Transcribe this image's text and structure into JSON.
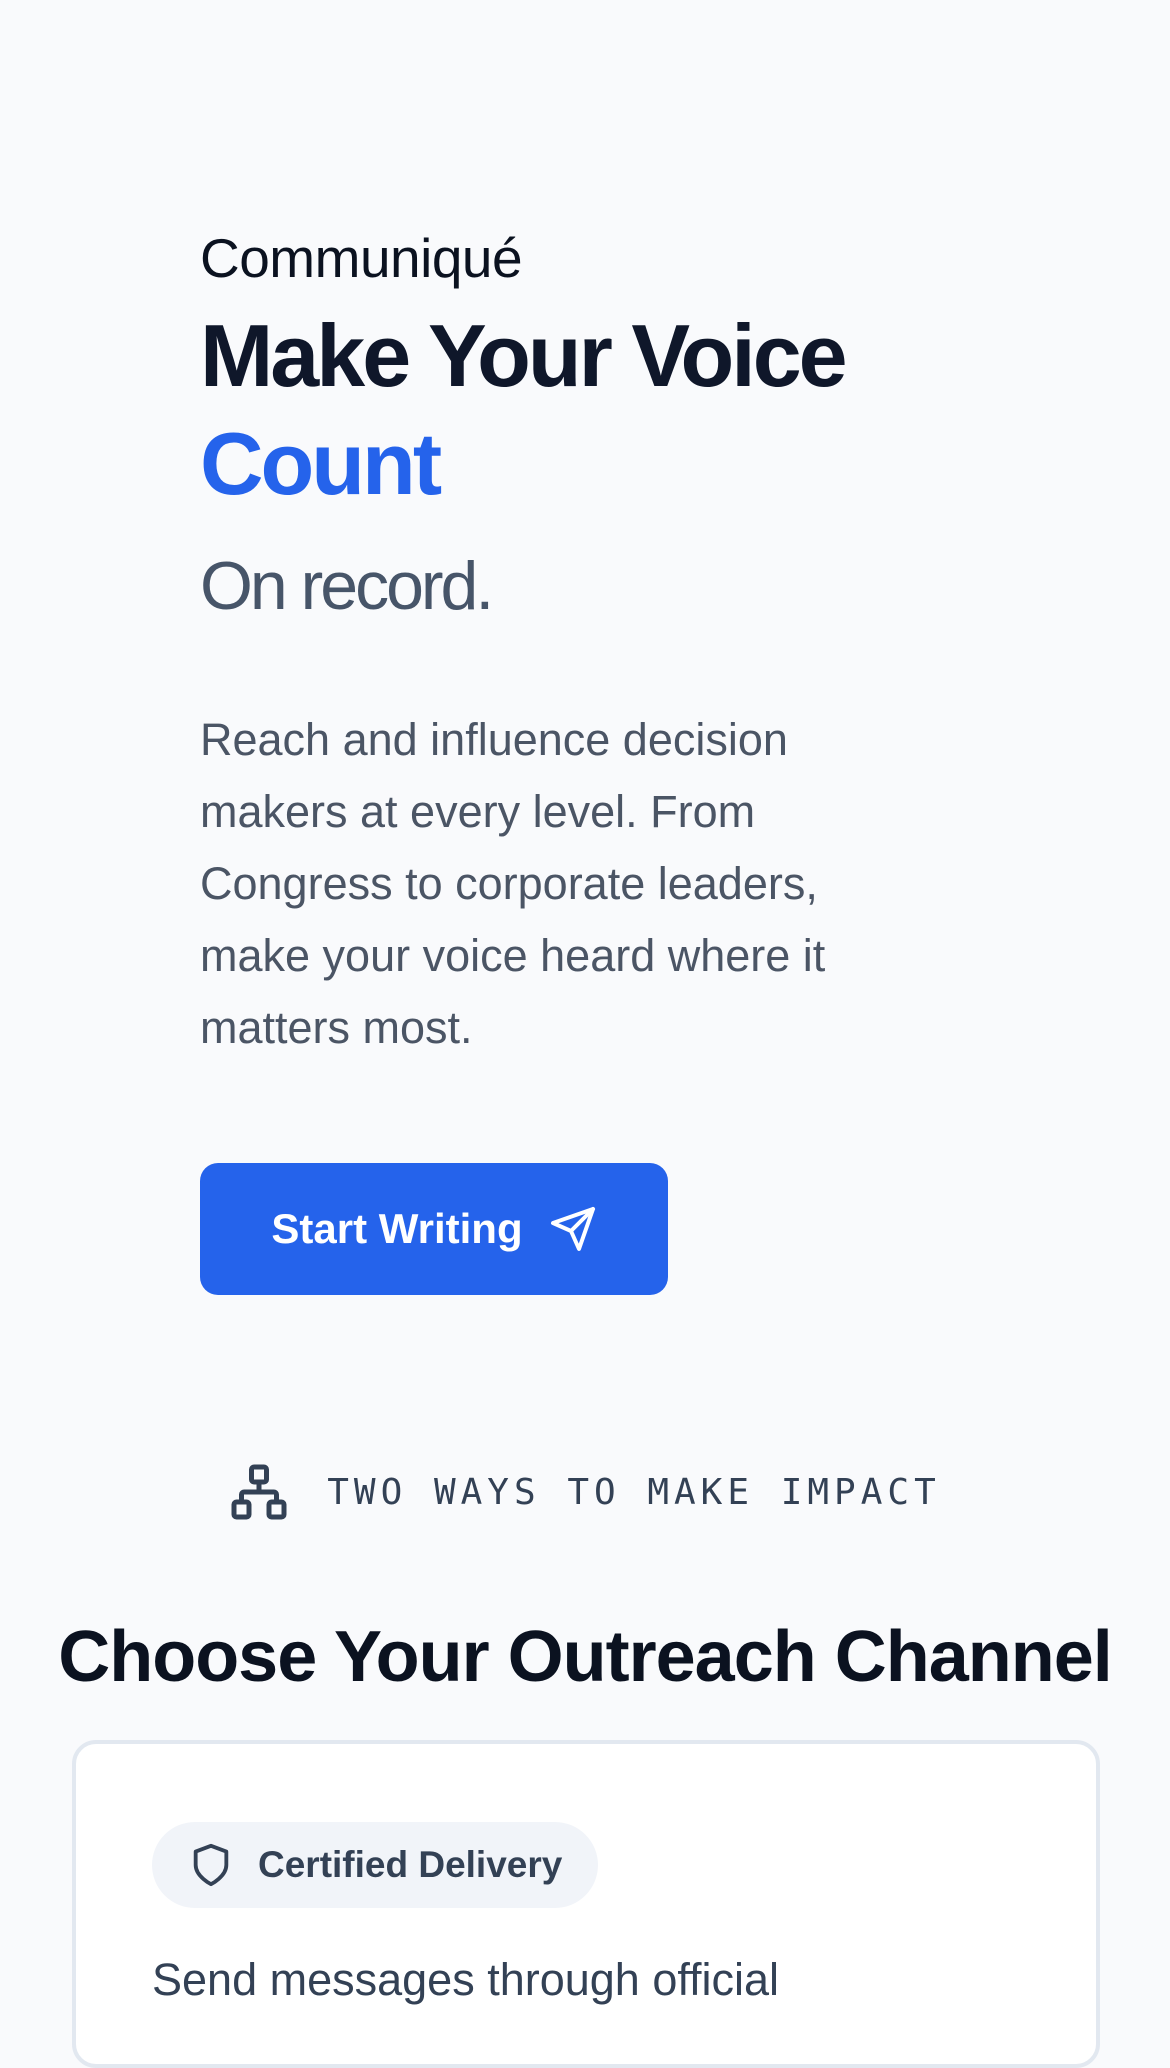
{
  "hero": {
    "brand": "Communiqué",
    "headline_main": "Make Your Voice",
    "headline_accent": "Count",
    "subhead": "On record.",
    "description": "Reach and influence decision makers at every level. From Congress to corporate leaders, make your voice heard where it matters most.",
    "cta_label": "Start Writing",
    "cta_icon": "send-icon"
  },
  "section": {
    "kicker_icon": "network-icon",
    "kicker": "TWO WAYS TO MAKE IMPACT",
    "title": "Choose Your Outreach Channel"
  },
  "card": {
    "badge_icon": "shield-icon",
    "badge_label": "Certified Delivery",
    "text": "Send messages through official"
  },
  "colors": {
    "accent": "#2563eb",
    "background": "#f9fafc",
    "heading": "#0f172a",
    "muted": "#475569"
  }
}
